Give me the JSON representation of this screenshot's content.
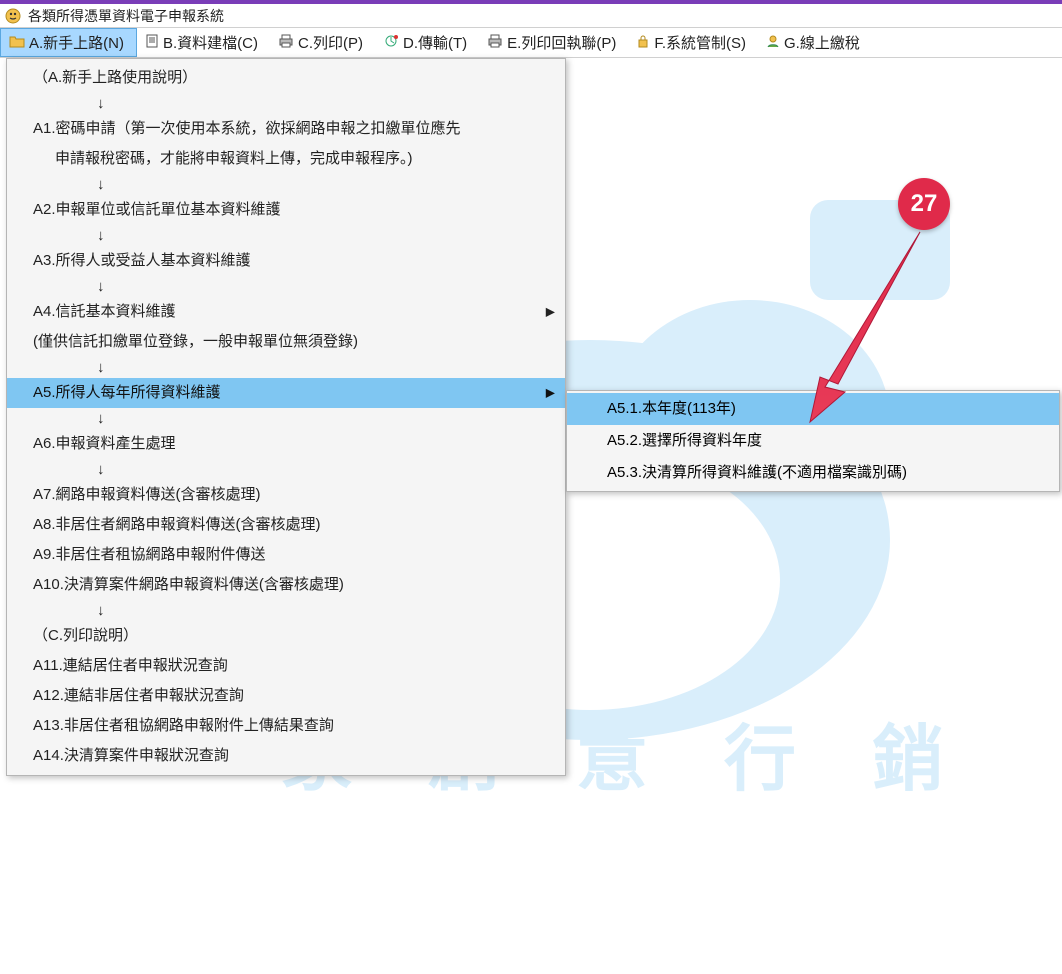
{
  "window": {
    "title": "各類所得憑單資料電子申報系統"
  },
  "menubar": [
    {
      "icon": "folder",
      "label": "A.新手上路(N)",
      "active": true
    },
    {
      "icon": "doc",
      "label": "B.資料建檔(C)"
    },
    {
      "icon": "print",
      "label": "C.列印(P)"
    },
    {
      "icon": "transfer",
      "label": "D.傳輸(T)"
    },
    {
      "icon": "print",
      "label": "E.列印回執聯(P)"
    },
    {
      "icon": "lock",
      "label": "F.系統管制(S)"
    },
    {
      "icon": "user",
      "label": "G.線上繳稅"
    }
  ],
  "dropdown": [
    {
      "type": "row",
      "text": "（A.新手上路使用說明）"
    },
    {
      "type": "down"
    },
    {
      "type": "row",
      "text": "A1.密碼申請（第一次使用本系統，欲採網路申報之扣繳單位應先"
    },
    {
      "type": "row2",
      "text": "申請報稅密碼，才能將申報資料上傳，完成申報程序。)"
    },
    {
      "type": "down"
    },
    {
      "type": "row",
      "text": "A2.申報單位或信託單位基本資料維護"
    },
    {
      "type": "down"
    },
    {
      "type": "row",
      "text": "A3.所得人或受益人基本資料維護"
    },
    {
      "type": "down"
    },
    {
      "type": "row",
      "text": "A4.信託基本資料維護",
      "expand": true
    },
    {
      "type": "row",
      "text": "(僅供信託扣繳單位登錄，一般申報單位無須登錄)"
    },
    {
      "type": "down"
    },
    {
      "type": "row",
      "text": "A5.所得人每年所得資料維護",
      "expand": true,
      "highlight": true
    },
    {
      "type": "down"
    },
    {
      "type": "row",
      "text": "A6.申報資料產生處理"
    },
    {
      "type": "down"
    },
    {
      "type": "row",
      "text": "A7.網路申報資料傳送(含審核處理)"
    },
    {
      "type": "row",
      "text": "A8.非居住者網路申報資料傳送(含審核處理)"
    },
    {
      "type": "row",
      "text": "A9.非居住者租協網路申報附件傳送"
    },
    {
      "type": "row",
      "text": "A10.決清算案件網路申報資料傳送(含審核處理)"
    },
    {
      "type": "down"
    },
    {
      "type": "row",
      "text": "（C.列印說明）"
    },
    {
      "type": "row",
      "text": "A11.連結居住者申報狀況查詢"
    },
    {
      "type": "row",
      "text": "A12.連結非居住者申報狀況查詢"
    },
    {
      "type": "row",
      "text": "A13.非居住者租協網路申報附件上傳結果查詢"
    },
    {
      "type": "row",
      "text": "A14.決清算案件申報狀況查詢"
    }
  ],
  "submenu": [
    {
      "text": "A5.1.本年度(113年)",
      "highlight": true
    },
    {
      "text": "A5.2.選擇所得資料年度"
    },
    {
      "text": "A5.3.決清算所得資料維護(不適用檔案識別碼)"
    }
  ],
  "callout": {
    "number": "27"
  },
  "watermark": {
    "line": "家 創 意 行 銷"
  }
}
